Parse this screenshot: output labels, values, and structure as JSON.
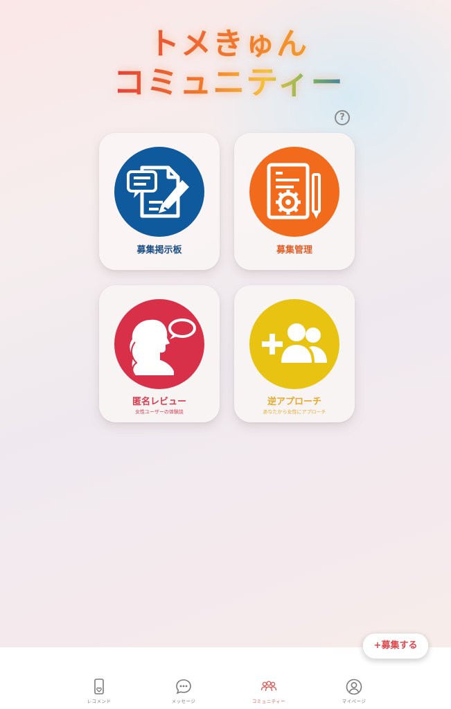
{
  "app": {
    "logo_line1": "トメきゅん",
    "logo_line2": "コミュニティー",
    "help_label": "?"
  },
  "menu": [
    {
      "title": "募集掲示板",
      "subtitle": "",
      "color": "#0f5a9c",
      "title_color": "#1b4f86",
      "icon": "document-pen-icon"
    },
    {
      "title": "募集管理",
      "subtitle": "",
      "color": "#f26a1b",
      "title_color": "#e2602a",
      "icon": "document-gear-icon"
    },
    {
      "title": "匿名レビュー",
      "subtitle": "女性ユーザーの体験談",
      "color": "#d9304a",
      "title_color": "#d93a4d",
      "icon": "woman-speech-icon"
    },
    {
      "title": "逆アプローチ",
      "subtitle": "あなたから女性にアプローチ",
      "color": "#e8c312",
      "title_color": "#e6a92a",
      "icon": "add-users-icon"
    }
  ],
  "fab": {
    "label": "+募集する",
    "color": "#e0464a"
  },
  "tabs": [
    {
      "label": "レコメンド",
      "icon": "phone-heart-icon",
      "active": false
    },
    {
      "label": "メッセージ",
      "icon": "chat-bubble-icon",
      "active": false
    },
    {
      "label": "コミュニティー",
      "icon": "community-icon",
      "active": true
    },
    {
      "label": "マイページ",
      "icon": "user-circle-icon",
      "active": false
    }
  ]
}
